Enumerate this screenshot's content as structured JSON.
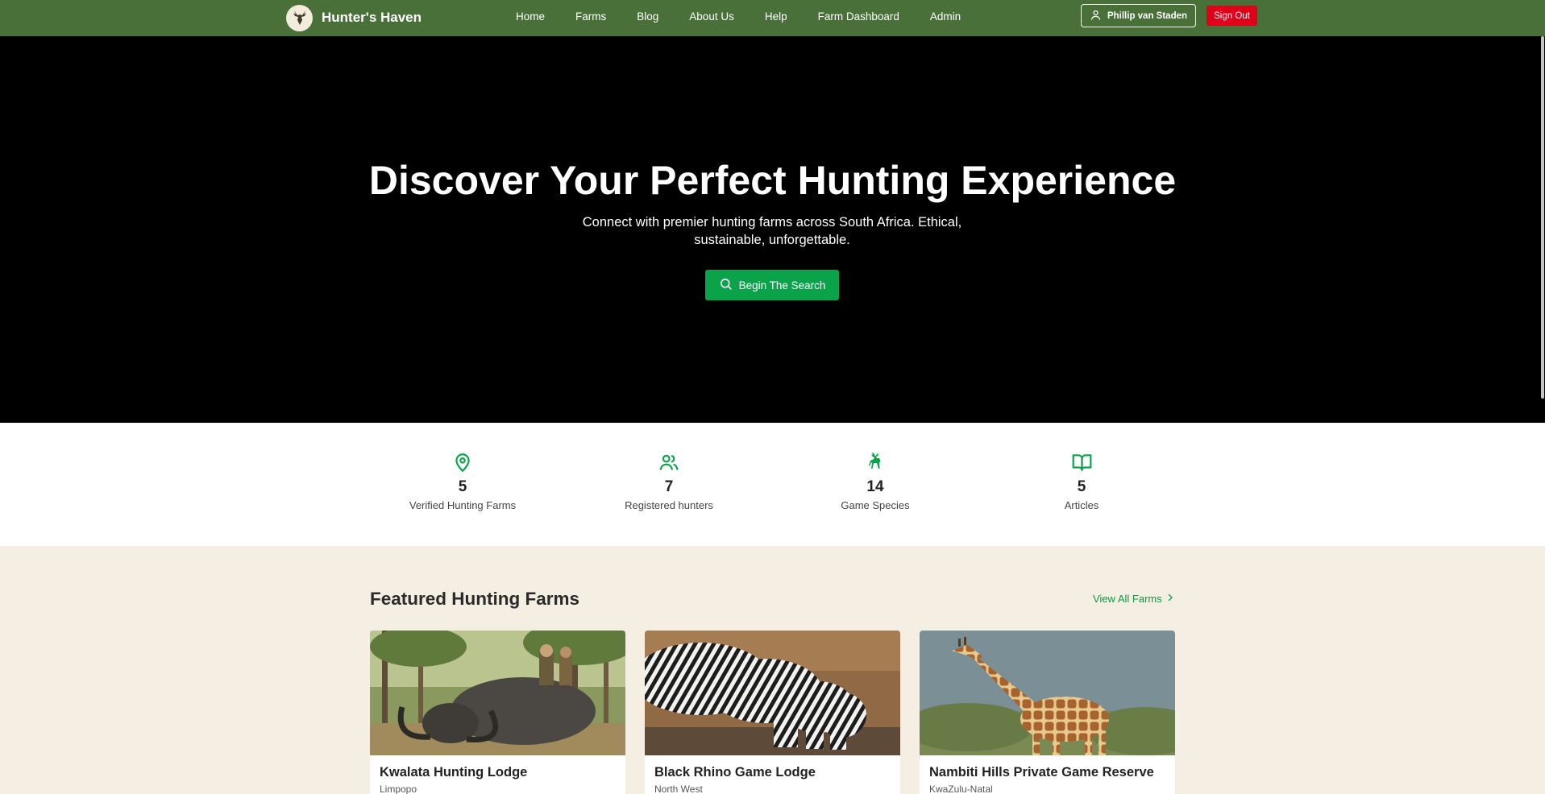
{
  "brand": {
    "name": "Hunter's Haven",
    "logo_icon": "deer-head-icon"
  },
  "nav": {
    "links": [
      {
        "label": "Home"
      },
      {
        "label": "Farms"
      },
      {
        "label": "Blog"
      },
      {
        "label": "About Us"
      },
      {
        "label": "Help"
      },
      {
        "label": "Farm Dashboard"
      },
      {
        "label": "Admin"
      }
    ],
    "user_label": "Phillip van Staden",
    "signout_label": "Sign Out"
  },
  "hero": {
    "title": "Discover Your Perfect Hunting Experience",
    "subtitle": "Connect with premier hunting farms across South Africa. Ethical, sustainable, unforgettable.",
    "cta_label": "Begin The Search"
  },
  "stats": [
    {
      "icon": "map-pin-icon",
      "value": "5",
      "label": "Verified Hunting Farms"
    },
    {
      "icon": "users-icon",
      "value": "7",
      "label": "Registered hunters"
    },
    {
      "icon": "deer-icon",
      "value": "14",
      "label": "Game Species"
    },
    {
      "icon": "book-open-icon",
      "value": "5",
      "label": "Articles"
    }
  ],
  "featured": {
    "title": "Featured Hunting Farms",
    "view_all_label": "View All Farms",
    "farms": [
      {
        "name": "Kwalata Hunting Lodge",
        "location": "Limpopo"
      },
      {
        "name": "Black Rhino Game Lodge",
        "location": "North West"
      },
      {
        "name": "Nambiti Hills Private Game Reserve",
        "location": "KwaZulu-Natal"
      }
    ]
  },
  "colors": {
    "nav_bg": "#4a7039",
    "accent_green": "#0aa34a",
    "signout_red": "#e1001a",
    "page_bg": "#f5efe3"
  }
}
